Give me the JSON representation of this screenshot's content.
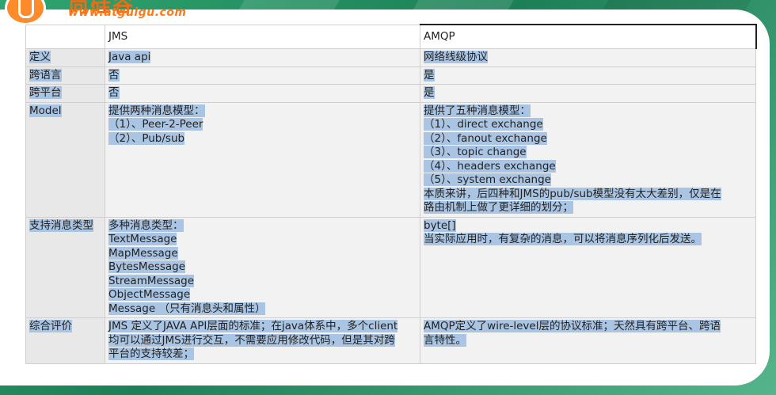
{
  "logo": {
    "url": "www.atguigu.com"
  },
  "table": {
    "headers": [
      "",
      "JMS",
      "AMQP"
    ],
    "rows": [
      {
        "label": "定义",
        "jms": [
          "Java api"
        ],
        "amqp": [
          "网络线级协议"
        ]
      },
      {
        "label": "跨语言",
        "jms": [
          "否"
        ],
        "amqp": [
          "是"
        ]
      },
      {
        "label": "跨平台",
        "jms": [
          "否"
        ],
        "amqp": [
          "是"
        ]
      },
      {
        "label": "Model",
        "jms": [
          "提供两种消息模型：",
          "（1）、Peer-2-Peer",
          "（2）、Pub/sub"
        ],
        "amqp": [
          "提供了五种消息模型：",
          "（1）、direct exchange",
          "（2）、fanout exchange",
          "（3）、topic change",
          "（4）、headers exchange",
          "（5）、system exchange",
          "本质来讲，后四种和JMS的pub/sub模型没有太大差别，仅是在",
          "路由机制上做了更详细的划分；"
        ]
      },
      {
        "label": "支持消息类型",
        "jms": [
          "多种消息类型：",
          "TextMessage",
          "MapMessage",
          "BytesMessage",
          "StreamMessage",
          "ObjectMessage",
          "Message （只有消息头和属性）"
        ],
        "amqp": [
          "byte[]",
          "当实际应用时，有复杂的消息，可以将消息序列化后发送。"
        ]
      },
      {
        "label": "综合评价",
        "jms": [
          "JMS 定义了JAVA API层面的标准；在java体系中，多个client",
          "均可以通过JMS进行交互，不需要应用修改代码，但是其对跨",
          "平台的支持较差；"
        ],
        "amqp": [
          "AMQP定义了wire-level层的协议标准；天然具有跨平台、跨语",
          "言特性。"
        ]
      }
    ]
  }
}
